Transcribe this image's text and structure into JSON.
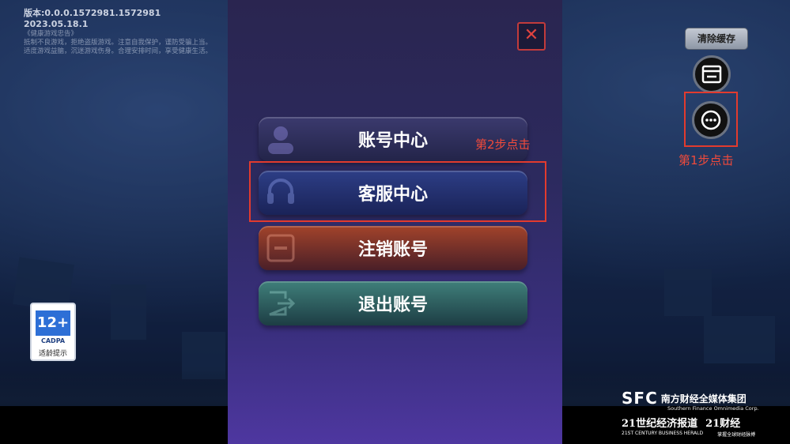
{
  "version": {
    "line1": "版本:0.0.0.1572981.1572981 2023.05.18.1",
    "line2": "《健康游戏忠告》",
    "line3": "抵制不良游戏，拒绝盗版游戏。注意自我保护，谨防受骗上当。",
    "line4": "适度游戏益脑，沉迷游戏伤身。合理安排时间，享受健康生活。"
  },
  "age_rating": {
    "age": "12+",
    "org": "CADPA",
    "tip": "适龄提示"
  },
  "panel": {
    "close_label": "✕",
    "buttons": [
      {
        "label": "账号中心",
        "icon": "user-icon"
      },
      {
        "label": "客服中心",
        "icon": "headset-icon"
      },
      {
        "label": "注销账号",
        "icon": "delete-account-icon"
      },
      {
        "label": "退出账号",
        "icon": "logout-icon"
      }
    ]
  },
  "annotations": {
    "step1": "第1步点击",
    "step2": "第2步点击",
    "highlight_color": "#e23b2e"
  },
  "right_tools": {
    "clear_cache": "清除缓存",
    "icons": [
      "notice-icon",
      "more-icon"
    ]
  },
  "watermark": {
    "sfc": "SFC",
    "cn": "南方财经全媒体集团",
    "en": "Southern Finance Omnimedia Corp.",
    "paper": "21世纪经济报道",
    "paper_en": "21ST CENTURY BUSINESS HERALD",
    "finance": "21财经",
    "finance_sub": "掌握全球财经脉搏"
  }
}
